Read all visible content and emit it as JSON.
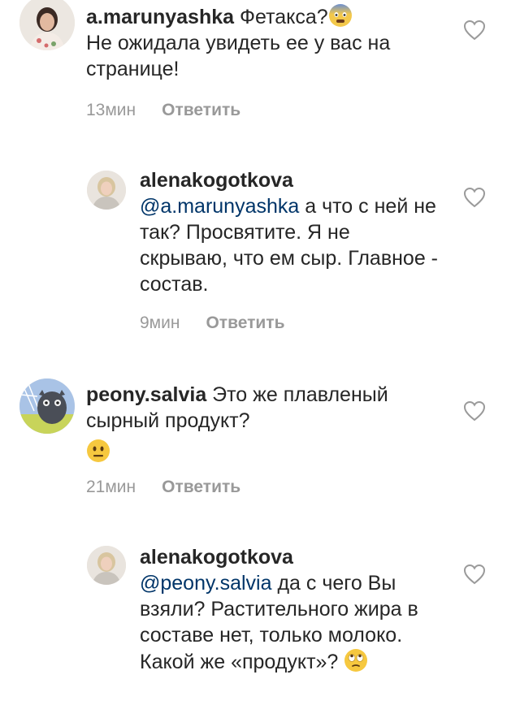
{
  "comments": [
    {
      "username": "a.marunyashka",
      "text_prefix": "Фетакса?",
      "text_after": "Не ожидала увидеть ее у вас на странице!",
      "emoji": "scared-face",
      "time": "13мин",
      "reply_label": "Ответить"
    },
    {
      "username": "alenakogotkova",
      "mention": "@a.marunyashka",
      "text": "а что с ней не так? Просвятите. Я не скрываю, что ем сыр. Главное - состав.",
      "time": "9мин",
      "reply_label": "Ответить"
    },
    {
      "username": "peony.salvia",
      "text": "Это же плавленый сырный продукт?",
      "emoji": "neutral-face",
      "time": "21мин",
      "reply_label": "Ответить"
    },
    {
      "username": "alenakogotkova",
      "mention": "@peony.salvia",
      "text": "да с чего Вы взяли? Растительного жира в составе нет, только молоко. Какой же «продукт»?",
      "emoji": "eye-roll-face"
    }
  ],
  "icons": {
    "like": "heart-outline-icon"
  },
  "colors": {
    "text": "#262626",
    "mention": "#003569",
    "meta": "#999999"
  }
}
